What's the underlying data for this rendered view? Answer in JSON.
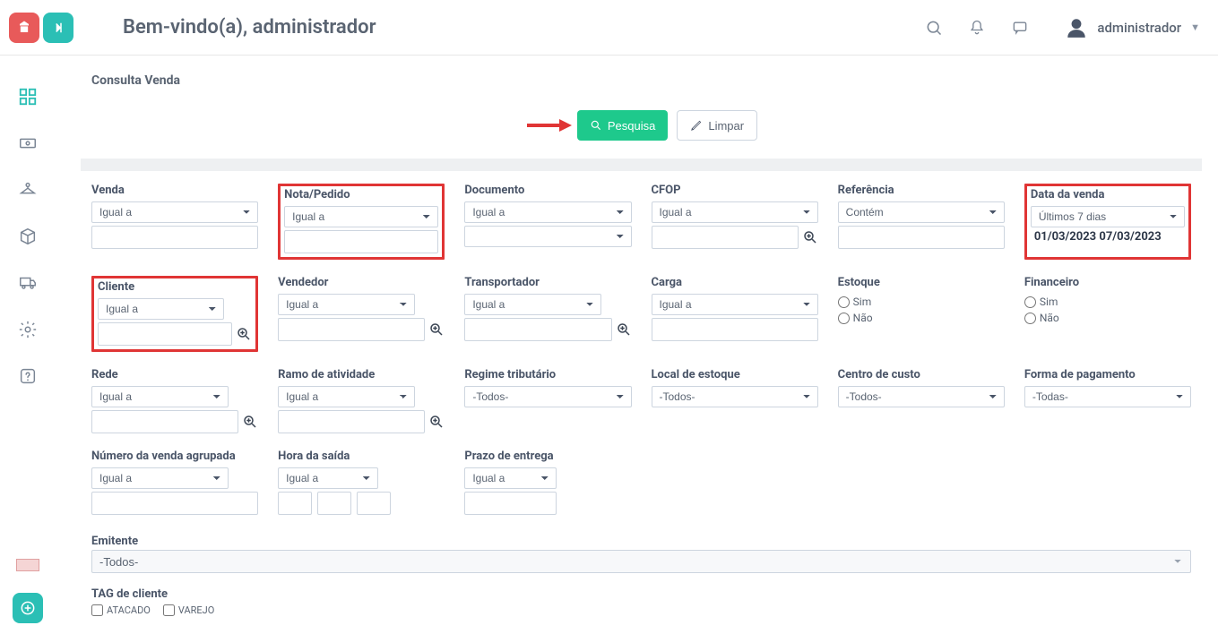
{
  "header": {
    "welcome": "Bem-vindo(a), administrador",
    "user_name": "administrador"
  },
  "page": {
    "title": "Consulta Venda",
    "buttons": {
      "search": "Pesquisa",
      "clear": "Limpar"
    }
  },
  "common": {
    "op_igual": "Igual a",
    "op_contem": "Contém",
    "todos": "-Todos-",
    "todas": "-Todas-",
    "sim": "Sim",
    "nao": "Não",
    "ultimos7": "Últimos 7 dias"
  },
  "fields": {
    "venda": {
      "label": "Venda"
    },
    "nota": {
      "label": "Nota/Pedido"
    },
    "documento": {
      "label": "Documento"
    },
    "cfop": {
      "label": "CFOP"
    },
    "referencia": {
      "label": "Referência"
    },
    "data_venda": {
      "label": "Data da venda",
      "range_text": "01/03/2023 07/03/2023"
    },
    "cliente": {
      "label": "Cliente"
    },
    "vendedor": {
      "label": "Vendedor"
    },
    "transportador": {
      "label": "Transportador"
    },
    "carga": {
      "label": "Carga"
    },
    "estoque": {
      "label": "Estoque"
    },
    "financeiro": {
      "label": "Financeiro"
    },
    "rede": {
      "label": "Rede"
    },
    "ramo": {
      "label": "Ramo de atividade"
    },
    "regime": {
      "label": "Regime tributário"
    },
    "local_estoque": {
      "label": "Local de estoque"
    },
    "centro_custo": {
      "label": "Centro de custo"
    },
    "forma_pag": {
      "label": "Forma de pagamento"
    },
    "num_agrup": {
      "label": "Número da venda agrupada"
    },
    "hora_saida": {
      "label": "Hora da saída"
    },
    "prazo_entrega": {
      "label": "Prazo de entrega"
    },
    "emitente": {
      "label": "Emitente"
    },
    "tag_cliente": {
      "label": "TAG de cliente",
      "opt_atacado": "ATACADO",
      "opt_varejo": "VAREJO"
    }
  }
}
